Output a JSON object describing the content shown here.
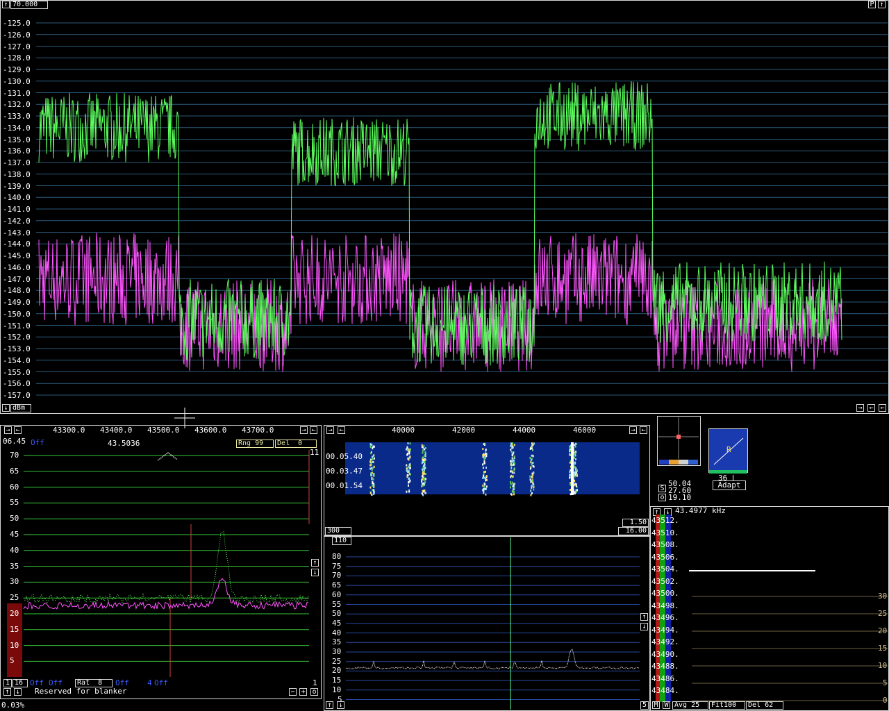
{
  "colors": {
    "green": "#5cff5c",
    "magenta": "#ff55ff",
    "gridBlue": "#2a4aa0",
    "gridGreen": "#38c838",
    "white": "#ffffff"
  },
  "top": {
    "freq_readout": "70.000",
    "p_button": "P",
    "unit_button": "dBm",
    "y_labels": [
      "-125.0",
      "-126.0",
      "-127.0",
      "-128.0",
      "-129.0",
      "-130.0",
      "-131.0",
      "-132.0",
      "-133.0",
      "-134.0",
      "-135.0",
      "-136.0",
      "-137.0",
      "-138.0",
      "-139.0",
      "-140.0",
      "-141.0",
      "-142.0",
      "-143.0",
      "-144.0",
      "-145.0",
      "-146.0",
      "-147.0",
      "-148.0",
      "-149.0",
      "-150.0",
      "-151.0",
      "-152.0",
      "-153.0",
      "-154.0",
      "-155.0",
      "-156.0",
      "-157.0"
    ]
  },
  "left": {
    "freq_scale": [
      "43300.0",
      "43400.0",
      "43500.0",
      "43600.0",
      "43700.0"
    ],
    "time": "06.45",
    "freq": "43.5036",
    "off1": "Off",
    "rng": "Rng 99",
    "del": "Del  0",
    "right_top": "11",
    "y_labels": [
      "70",
      "65",
      "60",
      "55",
      "50",
      "45",
      "40",
      "35",
      "30",
      "25",
      "20",
      "15",
      "10",
      "5"
    ],
    "bottom_val1": "1",
    "bottom_val2": "16",
    "bottom_off1": "Off",
    "bottom_off2": "Off",
    "rat": "Rat  8",
    "bottom_off3": "Off",
    "bottom_off4": "Off",
    "bottom_num": "4",
    "right_num": "1",
    "reserved": "Reserved for blanker",
    "status": "0.03%"
  },
  "middle": {
    "freq_scale": [
      "40000",
      "42000",
      "44000",
      "46000"
    ],
    "times": [
      "00.05.40",
      "00.03.47",
      "00.01.54"
    ],
    "val_300": "300",
    "val_150": "1.50",
    "val_1600": "16.00",
    "val_110": "110",
    "y_labels": [
      "80",
      "75",
      "70",
      "65",
      "60",
      "55",
      "50",
      "45",
      "40",
      "35",
      "30",
      "25",
      "20",
      "15",
      "10",
      "5"
    ],
    "bottom_num": "5"
  },
  "meters": {
    "s_label": "S",
    "o_label": "o",
    "v1": "50.04",
    "v2": "27.60",
    "v3": "19.10",
    "r_label": "R",
    "count": "36",
    "adapt": "Adapt"
  },
  "right": {
    "freq": "43.4977 kHz",
    "y_labels": [
      "43512.",
      "43510.",
      "43508.",
      "43506.",
      "43504.",
      "43502.",
      "43500.",
      "43498.",
      "43496.",
      "43494.",
      "43492.",
      "43490.",
      "43488.",
      "43486.",
      "43484."
    ],
    "right_scale": [
      "30",
      "25",
      "20",
      "15",
      "10",
      "5",
      "0"
    ],
    "m": "M",
    "w": "W",
    "avg": "Avg 25",
    "fit": "Fit100",
    "del": "Del 62"
  }
}
